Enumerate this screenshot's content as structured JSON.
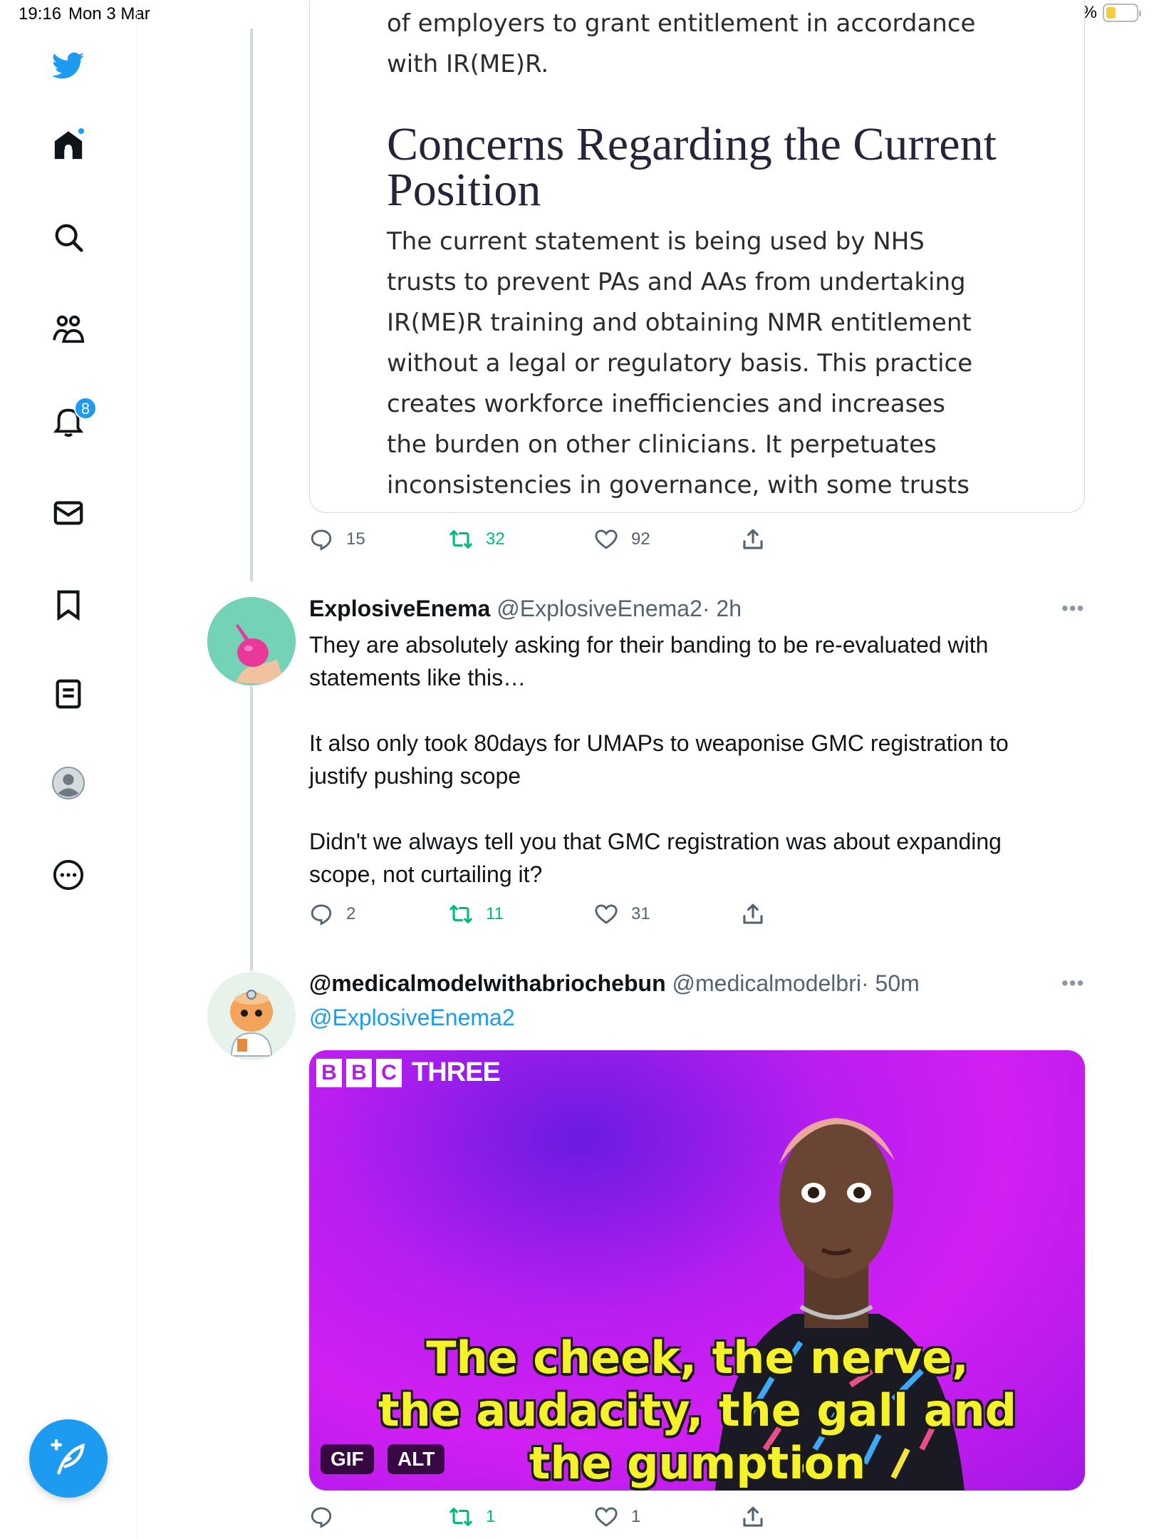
{
  "status_bar": {
    "time": "19:16",
    "date": "Mon 3 Mar",
    "battery_percent": "33%",
    "battery_level": 0.33
  },
  "sidebar": {
    "items": [
      {
        "name": "twitter-logo",
        "icon": "bird-icon"
      },
      {
        "name": "home",
        "icon": "home-icon"
      },
      {
        "name": "explore",
        "icon": "search-icon"
      },
      {
        "name": "communities",
        "icon": "people-icon"
      },
      {
        "name": "notifications",
        "icon": "bell-icon",
        "badge": "8"
      },
      {
        "name": "messages",
        "icon": "mail-icon"
      },
      {
        "name": "bookmarks",
        "icon": "bookmark-icon"
      },
      {
        "name": "lists",
        "icon": "list-icon"
      },
      {
        "name": "profile",
        "icon": "avatar-icon"
      },
      {
        "name": "more",
        "icon": "more-circle-icon"
      }
    ],
    "compose_icon": "compose-feather-icon"
  },
  "embedded_doc": {
    "top_text_1": "of employers to grant entitlement in accordance",
    "top_text_2": "with IR(ME)R.",
    "heading": "Concerns Regarding the Current Position",
    "body_lines": [
      "The current statement is being used by NHS",
      "trusts to prevent PAs and AAs from undertaking",
      "IR(ME)R training and obtaining NMR entitlement",
      "without a legal or regulatory basis. This practice",
      "creates workforce inefficiencies and increases",
      "the burden on other clinicians. It perpetuates",
      "inconsistencies in governance, with some trusts"
    ]
  },
  "tweet0_actions": {
    "replies": "15",
    "retweets": "32",
    "likes": "92"
  },
  "tweet1": {
    "name": "ExplosiveEnema",
    "handle": "@ExplosiveEnema2",
    "time": "· 2h",
    "body": "They are absolutely asking for their banding to be re-evaluated with statements like this…\n\nIt also only took 80days for UMAPs to weaponise GMC registration to justify pushing scope\n\nDidn't we always tell you that GMC registration was about expanding scope, not curtailing it?",
    "replies": "2",
    "retweets": "11",
    "likes": "31"
  },
  "tweet2": {
    "name": "@medicalmodelwithabriochebun",
    "handle": "@medicalmodelbri",
    "time": "· 50m",
    "mention": "@ExplosiveEnema2",
    "media": {
      "logo_letters": [
        "B",
        "B",
        "C"
      ],
      "logo_word": "THREE",
      "caption_line1": "The cheek, the nerve,",
      "caption_line2": "the audacity, the gall and",
      "caption_line3": "the gumption",
      "gif_tag": "GIF",
      "alt_tag": "ALT"
    },
    "replies": "",
    "retweets": "1",
    "likes": "1"
  },
  "colors": {
    "accent": "#1d9bf0",
    "retweet": "#00ba7c",
    "secondary_text": "#536471"
  }
}
